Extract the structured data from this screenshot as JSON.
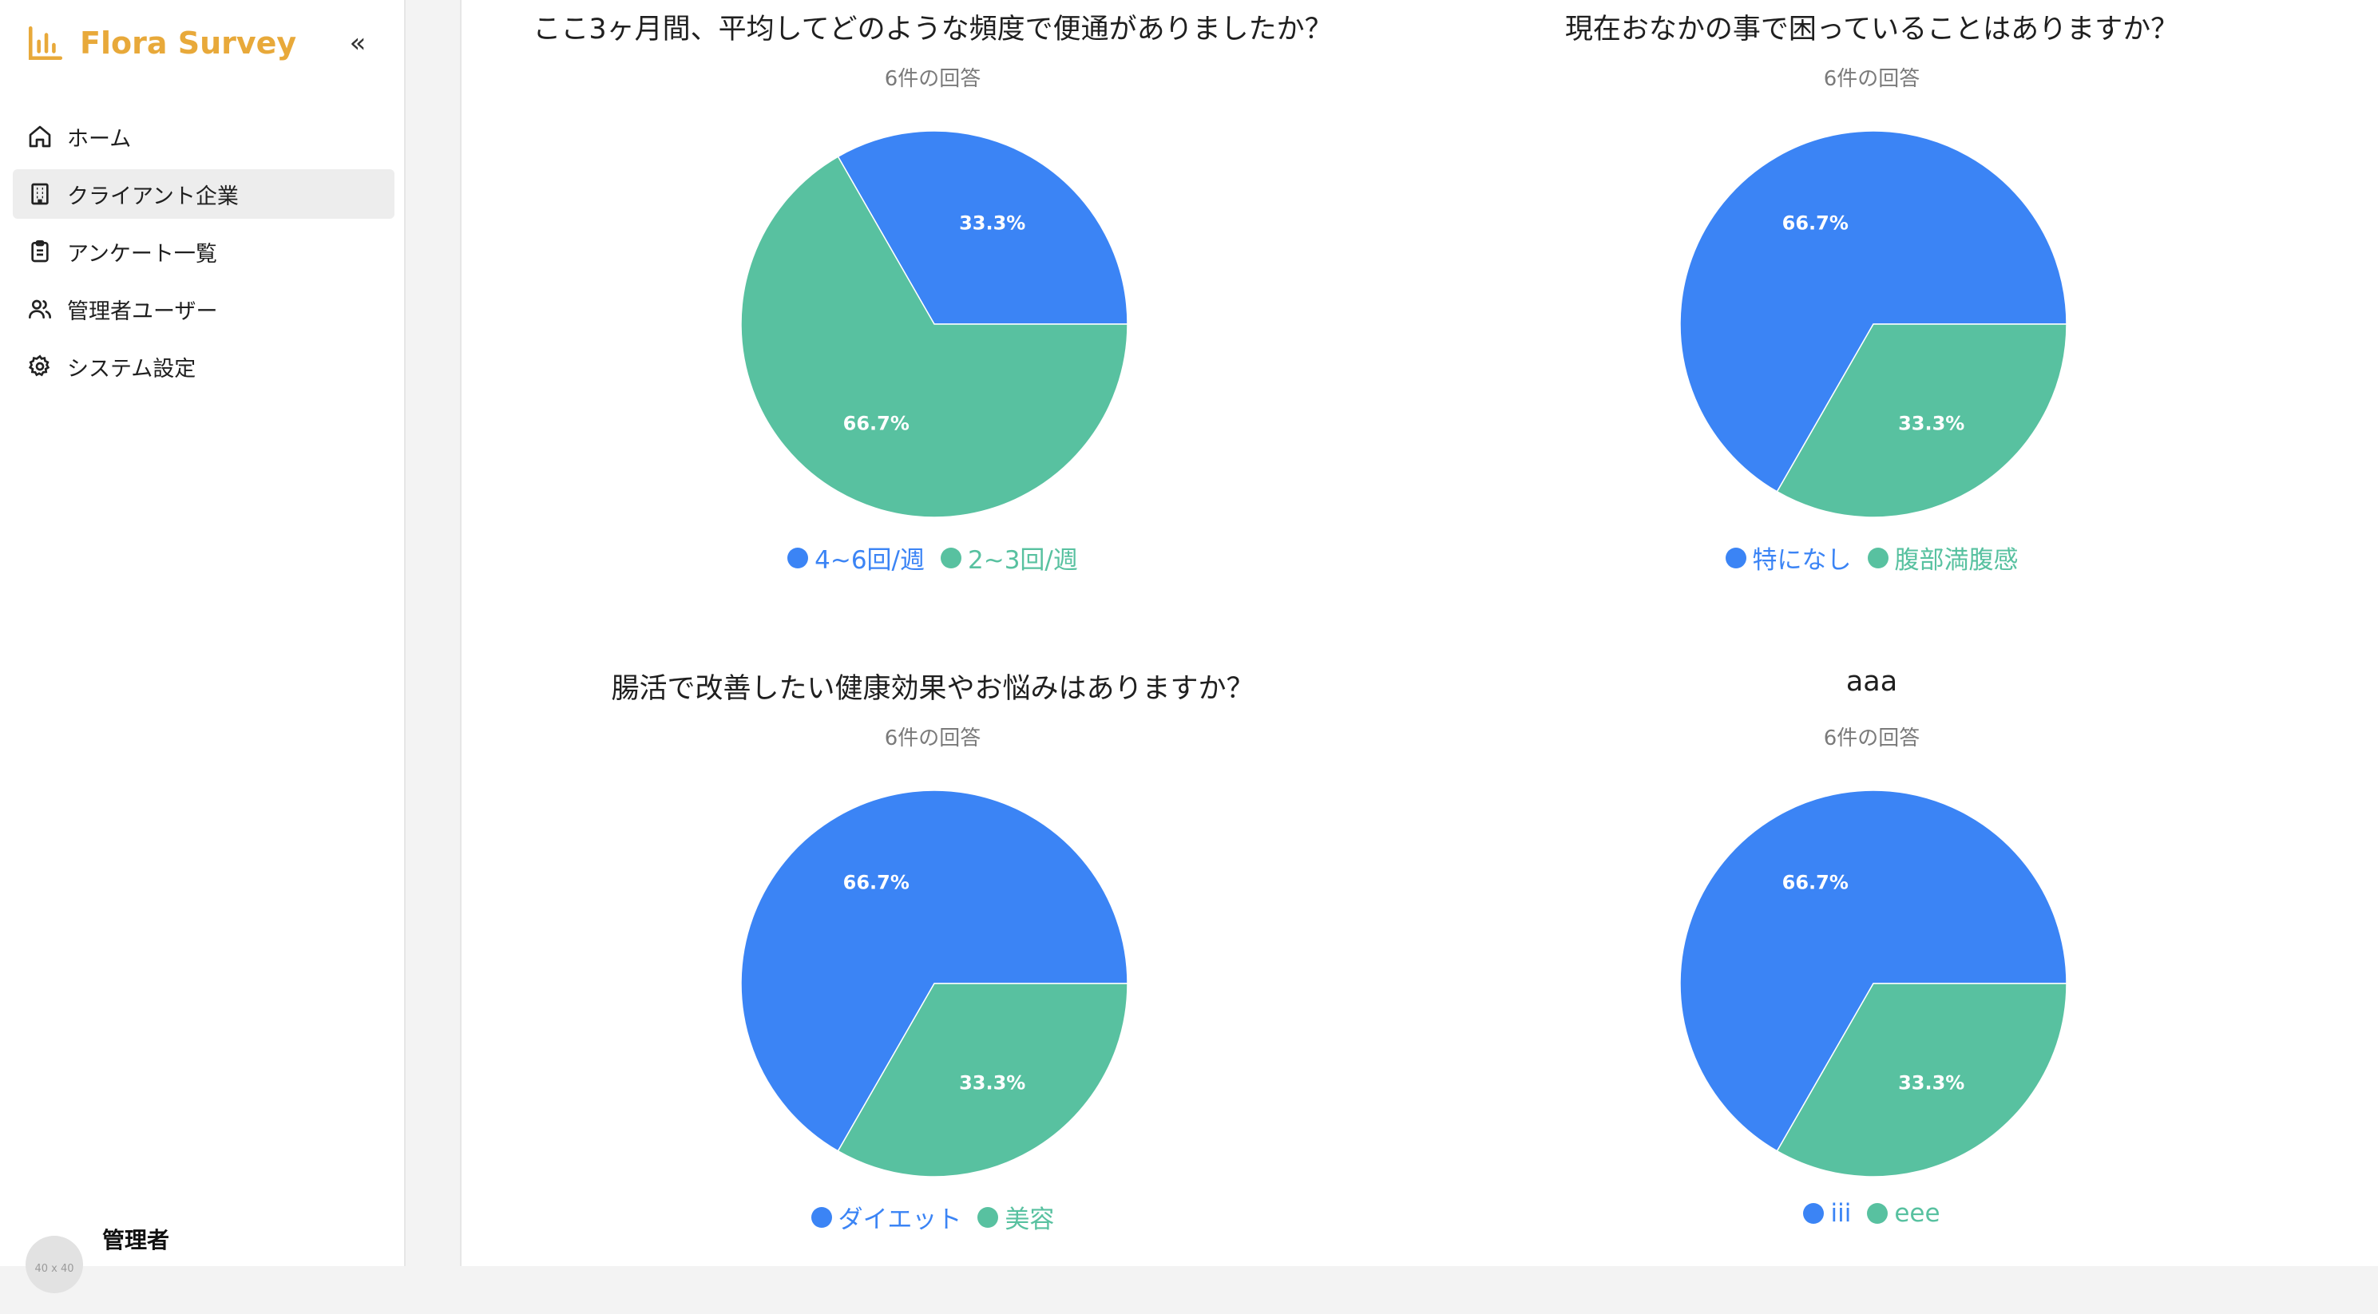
{
  "app": {
    "name": "Flora Survey",
    "collapse_glyph": "«"
  },
  "sidebar": {
    "items": [
      {
        "label": "ホーム",
        "icon": "home-icon",
        "active": false
      },
      {
        "label": "クライアント企業",
        "icon": "building-icon",
        "active": true
      },
      {
        "label": "アンケート一覧",
        "icon": "clipboard-icon",
        "active": false
      },
      {
        "label": "管理者ユーザー",
        "icon": "users-icon",
        "active": false
      },
      {
        "label": "システム設定",
        "icon": "gear-icon",
        "active": false
      }
    ],
    "user": {
      "name": "管理者",
      "avatar_text": "40 x 40"
    }
  },
  "colors": {
    "brand": "#e8a93a",
    "series_1": "#3b84f5",
    "series_2": "#58c1a0"
  },
  "chart_data": [
    {
      "type": "pie",
      "title": "ここ3ヶ月間、平均してどのような頻度で便通がありましたか？",
      "subtitle": "6件の回答",
      "labels": [
        "4~6回/週",
        "2~3回/週"
      ],
      "values": [
        33.3,
        66.7
      ],
      "value_labels": [
        "33.3%",
        "66.7%"
      ],
      "colors": [
        "#3b84f5",
        "#58c1a0"
      ],
      "legend": "bottom"
    },
    {
      "type": "pie",
      "title": "現在おなかの事で困っていることはありますか？",
      "subtitle": "6件の回答",
      "labels": [
        "特になし",
        "腹部満腹感"
      ],
      "values": [
        66.7,
        33.3
      ],
      "value_labels": [
        "66.7%",
        "33.3%"
      ],
      "colors": [
        "#3b84f5",
        "#58c1a0"
      ],
      "legend": "bottom"
    },
    {
      "type": "pie",
      "title": "腸活で改善したい健康効果やお悩みはありますか？",
      "subtitle": "6件の回答",
      "labels": [
        "ダイエット",
        "美容"
      ],
      "values": [
        66.7,
        33.3
      ],
      "value_labels": [
        "66.7%",
        "33.3%"
      ],
      "colors": [
        "#3b84f5",
        "#58c1a0"
      ],
      "legend": "bottom"
    },
    {
      "type": "pie",
      "title": "aaa",
      "subtitle": "6件の回答",
      "labels": [
        "iii",
        "eee"
      ],
      "values": [
        66.7,
        33.3
      ],
      "value_labels": [
        "66.7%",
        "33.3%"
      ],
      "colors": [
        "#3b84f5",
        "#58c1a0"
      ],
      "legend": "bottom"
    }
  ]
}
